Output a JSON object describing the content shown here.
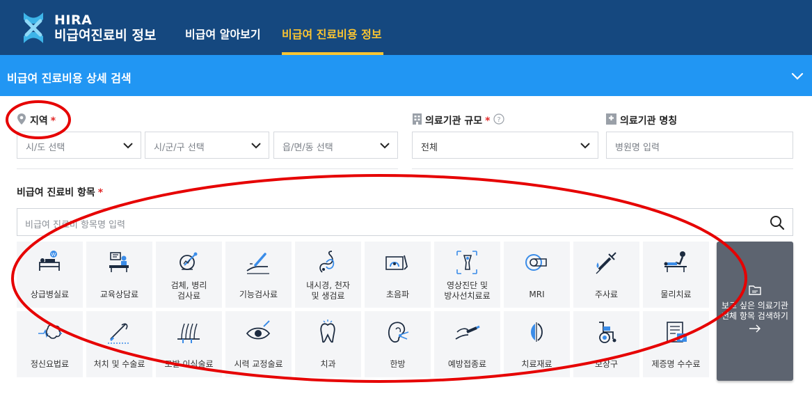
{
  "header": {
    "brand_line1": "HIRA",
    "brand_line2": "비급여진료비 정보",
    "nav": [
      "비급여 알아보기",
      "비급여 진료비용 정보"
    ],
    "active_color": "#fbc531",
    "bg_color": "#15487f"
  },
  "search_bar": {
    "title": "비급여 진료비용 상세 검색",
    "bg_color": "#2196f3"
  },
  "region": {
    "label": "지역",
    "required": "*",
    "selects": [
      "시/도 선택",
      "시/군/구 선택",
      "읍/면/동 선택"
    ]
  },
  "scale": {
    "label": "의료기관 규모",
    "required": "*",
    "value": "전체"
  },
  "name": {
    "label": "의료기관 명칭",
    "placeholder": "병원명 입력"
  },
  "items": {
    "label": "비급여 진료비 항목",
    "required": "*",
    "placeholder": "비급여 진료비 항목명 입력",
    "categories": [
      {
        "label": "상급병실료",
        "icon": "hospital-bed-icon"
      },
      {
        "label": "교육상담료",
        "icon": "counseling-desk-icon"
      },
      {
        "label": "검체, 병리\n검사료",
        "icon": "pathology-test-icon"
      },
      {
        "label": "기능검사료",
        "icon": "function-test-icon"
      },
      {
        "label": "내시경, 천자\n및 생검료",
        "icon": "endoscope-icon"
      },
      {
        "label": "초음파",
        "icon": "ultrasound-icon"
      },
      {
        "label": "영상진단 및\n방사선치료료",
        "icon": "radiology-icon"
      },
      {
        "label": "MRI",
        "icon": "mri-icon"
      },
      {
        "label": "주사료",
        "icon": "syringe-icon"
      },
      {
        "label": "물리치료",
        "icon": "physical-therapy-icon"
      },
      {
        "label": "정신요법료",
        "icon": "brain-icon"
      },
      {
        "label": "처치 및 수술료",
        "icon": "surgery-icon"
      },
      {
        "label": "모발 이식술료",
        "icon": "hair-transplant-icon"
      },
      {
        "label": "시력 교정술료",
        "icon": "eye-icon"
      },
      {
        "label": "치과",
        "icon": "tooth-icon"
      },
      {
        "label": "한방",
        "icon": "acupuncture-ear-icon"
      },
      {
        "label": "예방접종료",
        "icon": "vaccination-icon"
      },
      {
        "label": "치료재료",
        "icon": "medical-material-icon"
      },
      {
        "label": "보장구",
        "icon": "wheelchair-icon"
      },
      {
        "label": "제증명 수수료",
        "icon": "certificate-icon"
      }
    ],
    "all_button": "보고 싶은 의료기관\n전체 항목 검색하기"
  },
  "annotation_color": "#e60000"
}
